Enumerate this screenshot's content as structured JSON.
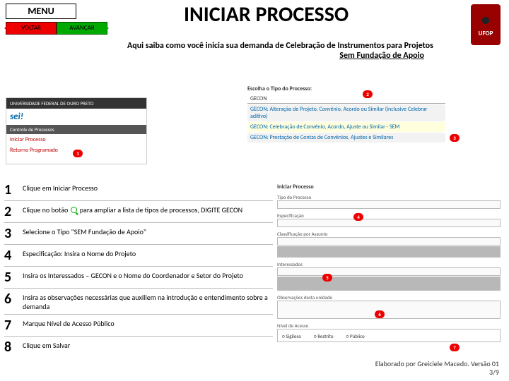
{
  "nav": {
    "menu": "MENU",
    "back": "VOLTAR",
    "forward": "AVANÇAR"
  },
  "title": "INICIAR PROCESSO",
  "subtitle_a": "Aqui saiba como você inicia sua demanda de Celebração de Instrumentos para Projetos ",
  "subtitle_b": "Sem Fundação de Apoio",
  "logo": "UFOP",
  "sei": {
    "uni": "UNIVERSIDADE FEDERAL DE OURO PRETO",
    "brand": "sei!",
    "bar": "Controle de Processos",
    "link1": "Iniciar Processo",
    "link2": "Retorno Programado"
  },
  "typelist": {
    "hdr": "Escolha o Tipo do Processo:",
    "filter": "GECON",
    "r1": "GECON: Alteração de Projeto, Convênio, Acordo ou Similar (inclusive Celebrar aditivo)",
    "r2": "GECON: Celebração de Convênio, Acordo, Ajuste ou Similar - SEM",
    "r3": "GECON: Prestação de Contas de Convênios, Ajustes e Similares"
  },
  "form": {
    "crumb": "Iniciar Processo",
    "f1": "Tipo do Processo",
    "f2": "Especificação",
    "f3": "Classificação por Assunto",
    "f4": "Interessados",
    "f5": "Observações desta unidade",
    "f6": "Nível de Acesso",
    "opt1": "Sigiloso",
    "opt2": "Restrito",
    "opt3": "Público"
  },
  "steps": {
    "s1": "Clique em Iniciar Processo",
    "s2a": "Clique no botão ",
    "s2b": " para ampliar a lista de tipos de processos, DIGITE GECON",
    "s3": "Selecione o Tipo \"SEM Fundação de Apoio\"",
    "s4": "Especificação: Insira o Nome do Projeto",
    "s5": "Insira os Interessados – GECON e o Nome do Coordenador e Setor do Projeto",
    "s6": "Insira as observações necessárias que auxiliem na introdução e entendimento sobre a demanda",
    "s7": "Marque Nível de Acesso Público",
    "s8": "Clique em Salvar"
  },
  "badges": {
    "b1": "1",
    "b2": "2",
    "b3": "3",
    "b4": "4",
    "b5": "5",
    "b6": "6",
    "b7": "7"
  },
  "footer": {
    "line1": "Elaborado por Greiciele Macedo. Versão 01",
    "line2": "3/9"
  }
}
